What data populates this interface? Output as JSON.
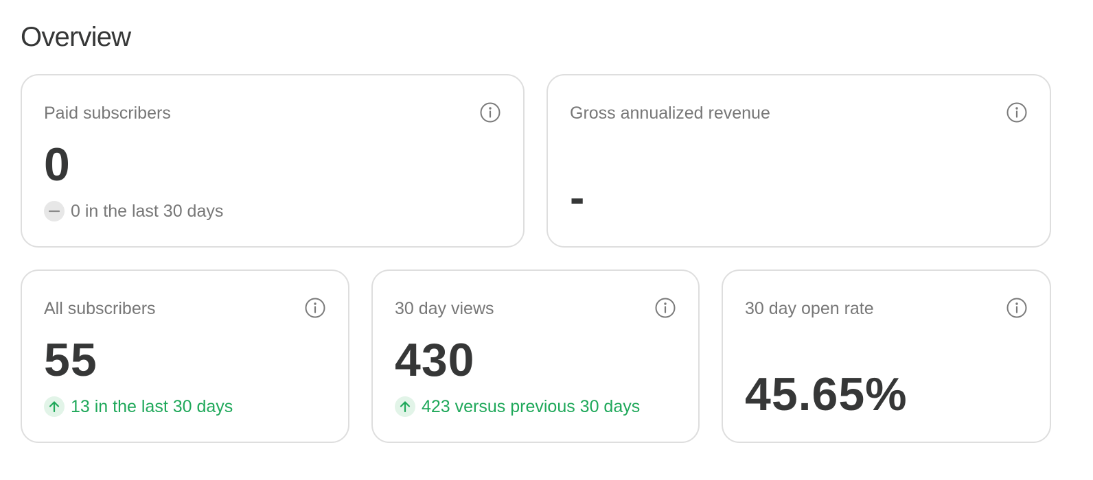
{
  "page": {
    "title": "Overview"
  },
  "colors": {
    "text_primary": "#363737",
    "text_secondary": "#777777",
    "positive": "#1fa85a",
    "card_border": "#dedede"
  },
  "cards": {
    "paid_subscribers": {
      "label": "Paid subscribers",
      "value": "0",
      "trend_text": "0 in the last 30 days",
      "trend_icon": "minus-icon",
      "info_icon": "info-icon"
    },
    "gross_revenue": {
      "label": "Gross annualized revenue",
      "value": "-",
      "info_icon": "info-icon"
    },
    "all_subscribers": {
      "label": "All subscribers",
      "value": "55",
      "trend_text": "13 in the last 30 days",
      "trend_icon": "arrow-up-icon",
      "info_icon": "info-icon"
    },
    "views_30_day": {
      "label": "30 day views",
      "value": "430",
      "trend_text": "423 versus previous 30 days",
      "trend_icon": "arrow-up-icon",
      "info_icon": "info-icon"
    },
    "open_rate_30_day": {
      "label": "30 day open rate",
      "value": "45.65%",
      "info_icon": "info-icon"
    }
  }
}
